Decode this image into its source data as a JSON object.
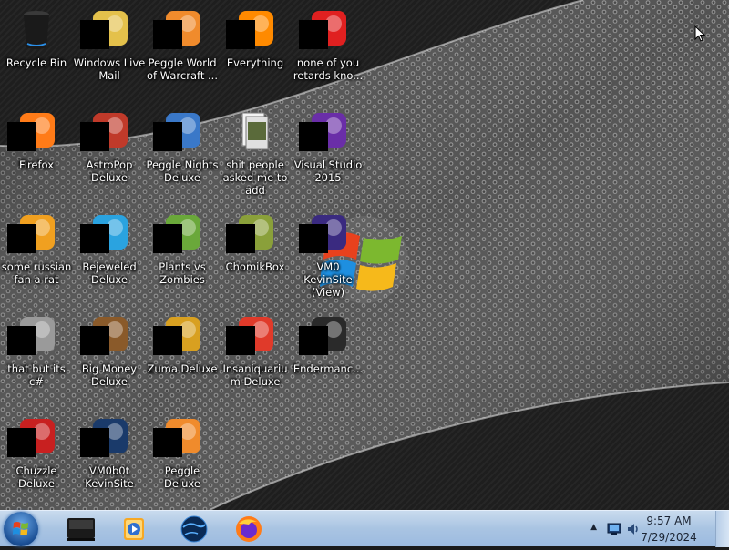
{
  "desktop": {
    "icons": [
      {
        "label": "Recycle Bin",
        "censored": false,
        "icon": "recycle-bin-icon"
      },
      {
        "label": "Windows Live Mail",
        "censored": true,
        "icon": "windows-live-mail-icon"
      },
      {
        "label": "Peggle World of Warcraft ...",
        "censored": true,
        "icon": "peggle-icon"
      },
      {
        "label": "Everything",
        "censored": true,
        "icon": "everything-search-icon"
      },
      {
        "label": "none of you retards kno...",
        "censored": true,
        "icon": "red-circle-icon"
      },
      {
        "label": "Firefox",
        "censored": true,
        "icon": "firefox-icon"
      },
      {
        "label": "AstroPop Deluxe",
        "censored": true,
        "icon": "astropop-icon"
      },
      {
        "label": "Peggle Nights Deluxe",
        "censored": true,
        "icon": "peggle-nights-icon"
      },
      {
        "label": "shit people asked me to add",
        "censored": false,
        "icon": "folder-icon"
      },
      {
        "label": "Visual Studio 2015",
        "censored": true,
        "icon": "visual-studio-icon"
      },
      {
        "label": "some russian fan a rat",
        "censored": true,
        "icon": "document-icon"
      },
      {
        "label": "Bejeweled Deluxe",
        "censored": true,
        "icon": "bejeweled-icon"
      },
      {
        "label": "Plants vs Zombies",
        "censored": true,
        "icon": "plants-vs-zombies-icon"
      },
      {
        "label": "ChomikBox",
        "censored": true,
        "icon": "chomikbox-icon"
      },
      {
        "label": "VM0 KevinSite (View)",
        "censored": true,
        "icon": "vm-icon"
      },
      {
        "label": "that but its c#",
        "censored": true,
        "icon": "stack-icon"
      },
      {
        "label": "Big Money Deluxe",
        "censored": true,
        "icon": "big-money-icon"
      },
      {
        "label": "Zuma Deluxe",
        "censored": true,
        "icon": "zuma-icon"
      },
      {
        "label": "Insaniquarium Deluxe",
        "censored": true,
        "icon": "insaniquarium-icon"
      },
      {
        "label": "Endermanc...",
        "censored": true,
        "icon": "terminal-icon"
      },
      {
        "label": "Chuzzle Deluxe",
        "censored": true,
        "icon": "chuzzle-icon"
      },
      {
        "label": "VM0b0t KevinSite",
        "censored": true,
        "icon": "vm-bot-icon"
      },
      {
        "label": "Peggle Deluxe",
        "censored": true,
        "icon": "peggle-deluxe-icon"
      }
    ]
  },
  "taskbar": {
    "start_icon": "windows-orb-icon",
    "pinned": [
      {
        "name": "media-center-icon"
      },
      {
        "name": "media-player-icon"
      },
      {
        "name": "globe-icon"
      },
      {
        "name": "firefox-icon"
      }
    ],
    "tray": {
      "time": "9:57 AM",
      "date": "7/29/2024"
    }
  }
}
